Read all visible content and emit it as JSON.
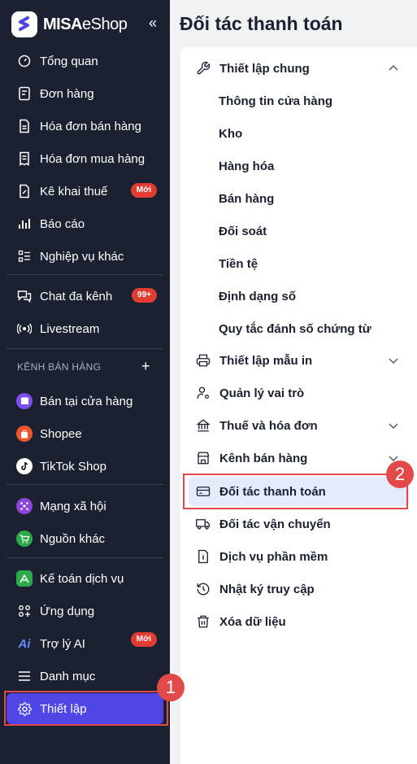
{
  "brand": {
    "name_bold": "MISA",
    "name_light": "eShop"
  },
  "sidebar": {
    "items": [
      {
        "label": "Tổng quan"
      },
      {
        "label": "Đơn hàng"
      },
      {
        "label": "Hóa đơn bán hàng"
      },
      {
        "label": "Hóa đơn mua hàng"
      },
      {
        "label": "Kê khai thuế",
        "badge": "Mới"
      },
      {
        "label": "Báo cáo"
      },
      {
        "label": "Nghiệp vụ khác"
      },
      {
        "label": "Chat đa kênh",
        "badge": "99+"
      },
      {
        "label": "Livestream"
      }
    ],
    "channels_title": "KÊNH BÁN HÀNG",
    "channels": [
      {
        "label": "Bán tại cửa hàng"
      },
      {
        "label": "Shopee"
      },
      {
        "label": "TikTok Shop"
      },
      {
        "label": "Mạng xã hội"
      },
      {
        "label": "Nguồn khác"
      }
    ],
    "bottom": [
      {
        "label": "Kế toán dịch vụ"
      },
      {
        "label": "Ứng dụng"
      },
      {
        "label": "Trợ lý AI",
        "badge": "Mới"
      },
      {
        "label": "Danh mục"
      },
      {
        "label": "Thiết lập"
      }
    ]
  },
  "main": {
    "title": "Đối tác thanh toán",
    "general": {
      "label": "Thiết lập chung",
      "children": [
        "Thông tin cửa hàng",
        "Kho",
        "Hàng hóa",
        "Bán hàng",
        "Đối soát",
        "Tiền tệ",
        "Định dạng số",
        "Quy tắc đánh số chứng từ"
      ]
    },
    "settings": [
      {
        "label": "Thiết lập mẫu in"
      },
      {
        "label": "Quản lý vai trò"
      },
      {
        "label": "Thuế và hóa đơn"
      },
      {
        "label": "Kênh bán hàng"
      },
      {
        "label": "Đối tác thanh toán"
      },
      {
        "label": "Đối tác vận chuyển"
      },
      {
        "label": "Dịch vụ phần mềm"
      },
      {
        "label": "Nhật ký truy cập"
      },
      {
        "label": "Xóa dữ liệu"
      }
    ]
  },
  "annotations": {
    "step1": "1",
    "step2": "2"
  },
  "colors": {
    "sidebar_bg": "#1b2130",
    "accent": "#4f46e5",
    "badge": "#e03c31",
    "highlight": "#e24a4a",
    "selected_bg": "#e6ebfb"
  }
}
